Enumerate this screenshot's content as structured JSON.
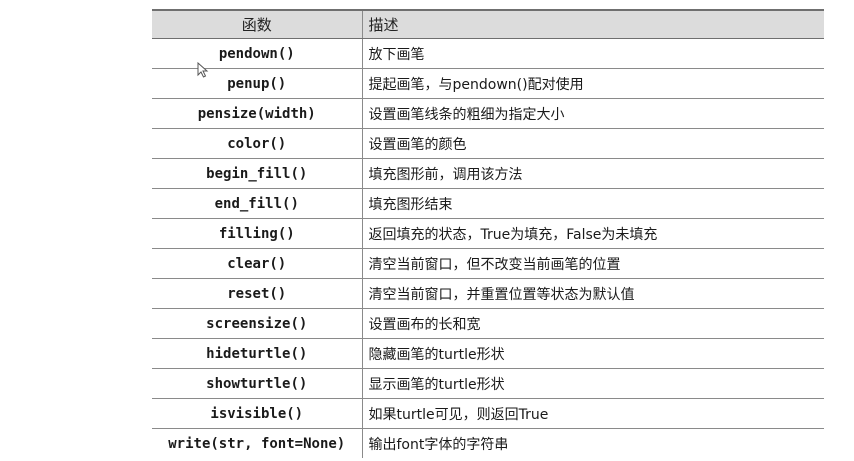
{
  "table": {
    "headers": [
      "函数",
      "描述"
    ],
    "rows": [
      {
        "fn": "pendown()",
        "desc": "放下画笔"
      },
      {
        "fn": "penup()",
        "desc": "提起画笔，与pendown()配对使用"
      },
      {
        "fn": "pensize(width)",
        "desc": "设置画笔线条的粗细为指定大小"
      },
      {
        "fn": "color()",
        "desc": "设置画笔的颜色"
      },
      {
        "fn": "begin_fill()",
        "desc": "填充图形前，调用该方法"
      },
      {
        "fn": "end_fill()",
        "desc": "填充图形结束"
      },
      {
        "fn": "filling()",
        "desc": "返回填充的状态，True为填充，False为未填充"
      },
      {
        "fn": "clear()",
        "desc": "清空当前窗口，但不改变当前画笔的位置"
      },
      {
        "fn": "reset()",
        "desc": "清空当前窗口，并重置位置等状态为默认值"
      },
      {
        "fn": "screensize()",
        "desc": "设置画布的长和宽"
      },
      {
        "fn": "hideturtle()",
        "desc": "隐藏画笔的turtle形状"
      },
      {
        "fn": "showturtle()",
        "desc": "显示画笔的turtle形状"
      },
      {
        "fn": "isvisible()",
        "desc": "如果turtle可见，则返回True"
      },
      {
        "fn": "write(str, font=None)",
        "desc": "输出font字体的字符串"
      }
    ]
  },
  "cursor_icon": "mouse-pointer-icon"
}
